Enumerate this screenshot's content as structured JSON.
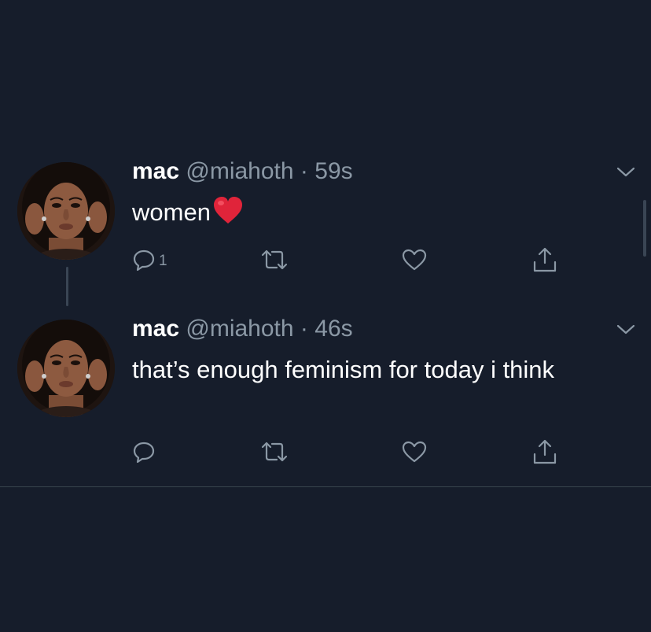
{
  "tweets": [
    {
      "name": "mac",
      "handle": "@miahoth",
      "separator": "·",
      "time": "59s",
      "text": "women",
      "emoji": "red-heart",
      "reply_count": "1"
    },
    {
      "name": "mac",
      "handle": "@miahoth",
      "separator": "·",
      "time": "46s",
      "text": "that’s enough feminism for today i think"
    }
  ],
  "icons": {
    "reply": "reply-icon",
    "retweet": "retweet-icon",
    "like": "like-icon",
    "share": "share-icon",
    "menu": "chevron-down-icon"
  },
  "colors": {
    "background": "#161d2b",
    "text_primary": "#ffffff",
    "text_secondary": "#8b98a5",
    "divider": "#38444d",
    "heart": "#e0243a"
  }
}
